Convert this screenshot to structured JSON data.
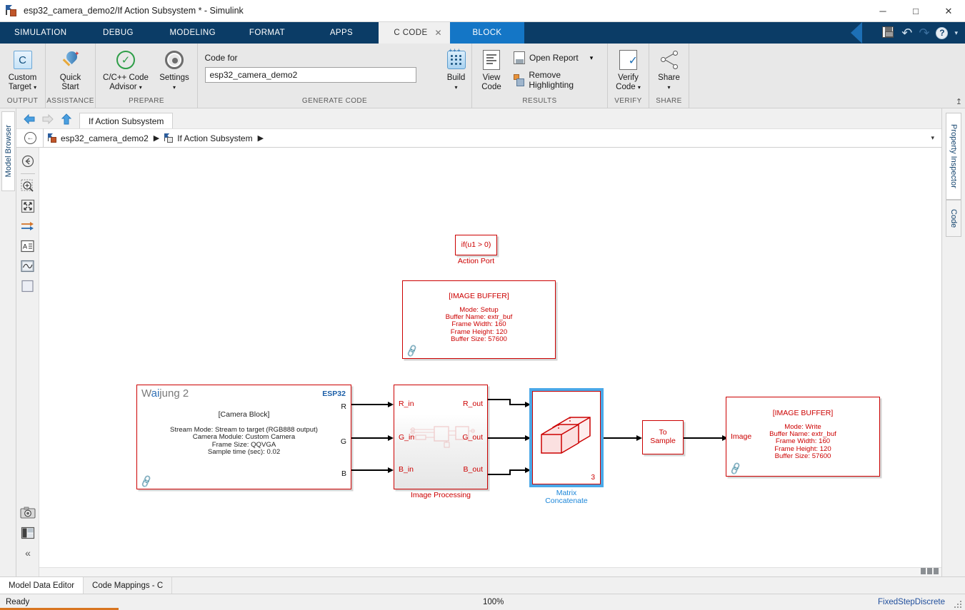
{
  "window": {
    "title": "esp32_camera_demo2/If Action Subsystem * - Simulink",
    "minimize": "─",
    "maximize": "□",
    "close": "✕"
  },
  "tabs": [
    {
      "label": "SIMULATION",
      "type": "plain"
    },
    {
      "label": "DEBUG",
      "type": "plain"
    },
    {
      "label": "MODELING",
      "type": "plain"
    },
    {
      "label": "FORMAT",
      "type": "plain"
    },
    {
      "label": "APPS",
      "type": "plain"
    },
    {
      "label": "C CODE",
      "type": "active-doc",
      "close": "✕"
    },
    {
      "label": "BLOCK",
      "type": "block-tab"
    }
  ],
  "quick_access": {
    "save": "save-icon",
    "undo": "↶",
    "redo": "↷",
    "help": "?",
    "more": "▾"
  },
  "ribbon": {
    "groups": [
      {
        "title": "OUTPUT",
        "buttons": [
          {
            "label": "Custom",
            "label2": "Target",
            "dropdown": "▾",
            "icon": "custom-target-icon"
          }
        ]
      },
      {
        "title": "ASSISTANCE",
        "buttons": [
          {
            "label": "Quick",
            "label2": "Start",
            "dropdown": "",
            "icon": "quick-start-icon"
          }
        ]
      },
      {
        "title": "PREPARE",
        "buttons": [
          {
            "label": "C/C++ Code",
            "label2": "Advisor",
            "dropdown": "▾",
            "icon": "code-advisor-icon"
          },
          {
            "label": "Settings",
            "label2": "",
            "dropdown": "▾",
            "icon": "settings-gear-icon"
          }
        ]
      },
      {
        "title": "GENERATE CODE",
        "code_for_label": "Code for",
        "code_for_value": "esp32_camera_demo2",
        "buttons": [
          {
            "label": "Build",
            "label2": "",
            "dropdown": "▾",
            "icon": "build-icon"
          }
        ]
      },
      {
        "title": "RESULTS",
        "buttons": [
          {
            "label": "View",
            "label2": "Code",
            "dropdown": "",
            "icon": "view-code-icon"
          }
        ],
        "items": [
          {
            "label": "Open Report",
            "icon": "open-report-icon",
            "dropdown": "▾"
          },
          {
            "label": "Remove Highlighting",
            "icon": "remove-highlighting-icon",
            "dropdown": ""
          }
        ]
      },
      {
        "title": "VERIFY",
        "buttons": [
          {
            "label": "Verify",
            "label2": "Code",
            "dropdown": "▾",
            "icon": "verify-code-icon"
          }
        ]
      },
      {
        "title": "SHARE",
        "buttons": [
          {
            "label": "Share",
            "label2": "",
            "dropdown": "▾",
            "icon": "share-icon"
          }
        ]
      }
    ],
    "collapse": "↥"
  },
  "left_dock": {
    "model_browser": "Model Browser"
  },
  "nav": {
    "back": "⇦",
    "forward": "⇨",
    "up": "⇧",
    "doc_tab": "If Action Subsystem",
    "breadcrumb_back": "←",
    "breadcrumb": [
      {
        "label": "esp32_camera_demo2",
        "icon": "model-icon"
      },
      {
        "label": "If Action Subsystem",
        "icon": "subsystem-icon"
      }
    ],
    "separator": "▶",
    "caret": "▾"
  },
  "canvas_tools": [
    {
      "name": "navigate-up-icon",
      "glyph": "←"
    },
    {
      "name": "zoom-in-icon",
      "glyph": "⊕"
    },
    {
      "name": "fit-to-view-icon",
      "glyph": "⛶"
    },
    {
      "name": "signal-routing-icon",
      "glyph": "⇥"
    },
    {
      "name": "annotation-icon",
      "glyph": "A"
    },
    {
      "name": "scope-icon",
      "glyph": "∿"
    },
    {
      "name": "area-icon",
      "glyph": "□"
    }
  ],
  "canvas_tools_bottom": [
    {
      "name": "screenshot-icon",
      "glyph": "◎"
    },
    {
      "name": "layout-icon",
      "glyph": "▣"
    },
    {
      "name": "collapse-toolbar-icon",
      "glyph": "«"
    }
  ],
  "diagram": {
    "action_port": {
      "condition": "if(u1 > 0)",
      "label": "Action Port"
    },
    "image_buffer_setup": {
      "title": "[IMAGE BUFFER]",
      "lines": [
        "Mode: Setup",
        "Buffer Name: extr_buf",
        "Frame Width: 160",
        "Frame Height: 120",
        "Buffer Size: 57600"
      ],
      "link_icon": "link-icon"
    },
    "camera_block": {
      "brand": "Waijung 2",
      "brand_highlight": "ai",
      "target": "ESP32",
      "title": "[Camera Block]",
      "lines": [
        "Stream Mode: Stream to target (RGB888 output)",
        "Camera Module: Custom Camera",
        "Frame Size: QQVGA",
        "Sample time (sec): 0.02"
      ],
      "ports": [
        "R",
        "G",
        "B"
      ],
      "link_icon": "link-icon"
    },
    "image_processing": {
      "label": "Image Processing",
      "inputs": [
        "R_in",
        "G_in",
        "B_in"
      ],
      "outputs": [
        "R_out",
        "G_out",
        "B_out"
      ]
    },
    "matrix_concatenate": {
      "label_line1": "Matrix",
      "label_line2": "Concatenate",
      "dimension": "3",
      "selected": true
    },
    "to_sample": {
      "line1": "To",
      "line2": "Sample"
    },
    "image_buffer_write": {
      "title": "[IMAGE BUFFER]",
      "input_port": "Image",
      "lines": [
        "Mode: Write",
        "Buffer Name: extr_buf",
        "Frame Width: 160",
        "Frame Height: 120",
        "Buffer Size: 57600"
      ],
      "link_icon": "link-icon"
    }
  },
  "right_dock": {
    "property_inspector": "Property Inspector",
    "code": "Code",
    "collapse": "▴"
  },
  "bottom_tabs": [
    {
      "label": "Model Data Editor",
      "active": true
    },
    {
      "label": "Code Mappings - C",
      "active": false
    }
  ],
  "status": {
    "message": "Ready",
    "zoom": "100%",
    "solver": "FixedStepDiscrete"
  },
  "colors": {
    "block_red": "#cc0000",
    "selection_blue": "#4aa8e8",
    "ribbon_bg": "#e8e8e8",
    "tabstrip_blue": "#0b3c66",
    "accent_blue": "#1476c6",
    "status_link": "#1f4e9c"
  }
}
